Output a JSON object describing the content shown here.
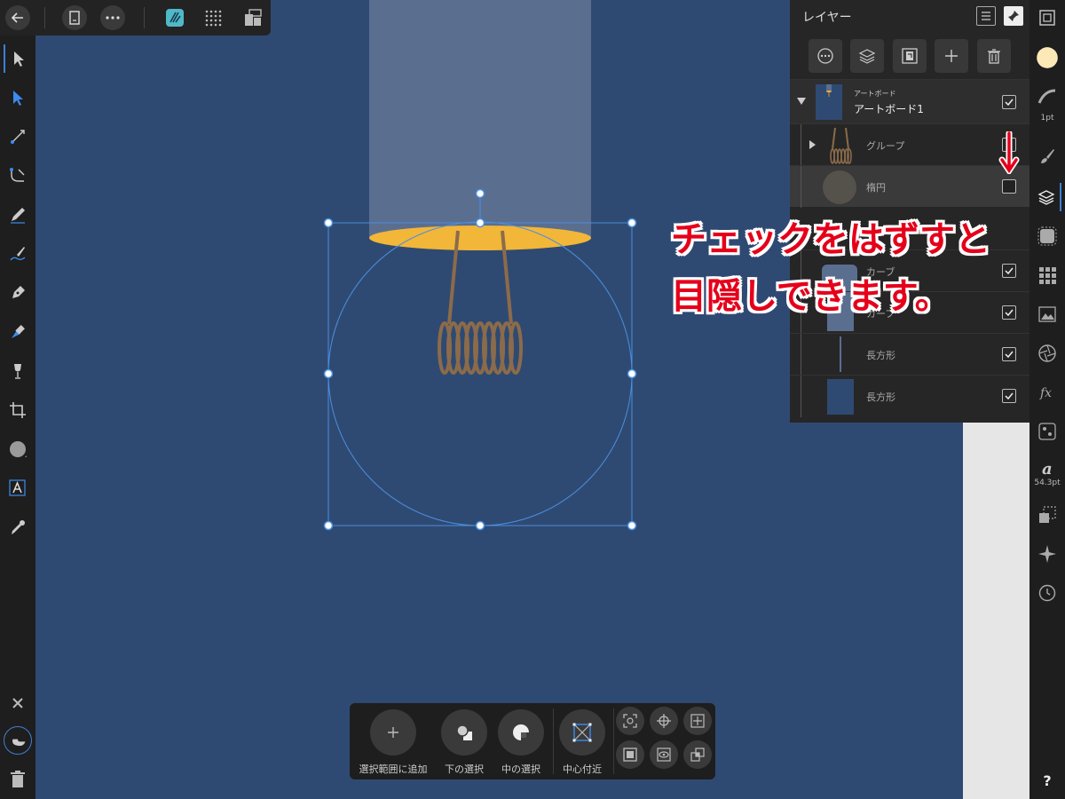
{
  "toolbar": {
    "back_icon": "arrow-left-icon",
    "document_icon": "document-icon",
    "more_icon": "more-icon",
    "persona_icon": "designer-persona-icon",
    "grid_icon": "grid-icon",
    "export_icon": "export-icon"
  },
  "layers_panel": {
    "title": "レイヤー",
    "rows": [
      {
        "sublabel": "アートボード",
        "label": "アートボード1",
        "checked": true
      },
      {
        "label": "グループ",
        "checked": false
      },
      {
        "label": "楕円",
        "checked": false
      },
      {
        "label": "カーブ",
        "checked": true
      },
      {
        "label": "カーブ",
        "checked": true
      },
      {
        "label": "長方形",
        "checked": true
      },
      {
        "label": "長方形",
        "checked": true
      }
    ]
  },
  "right_toolbar": {
    "stroke_width": "1pt",
    "font_size": "54.3pt",
    "help": "?"
  },
  "context_bar": {
    "add_selection": "選択範囲に追加",
    "select_under": "下の選択",
    "select_inside": "中の選択",
    "center_snap": "中心付近"
  },
  "annotation": {
    "line1": "チェックをはずすと",
    "line2": "目隠しできます。"
  },
  "colors": {
    "canvas": "#2f4a72",
    "bulb_cap": "#5a6e90",
    "bulb_base": "#f2b638",
    "filament": "#8b6b4a",
    "annotation": "#e5001a",
    "accent": "#3d7fd6"
  }
}
